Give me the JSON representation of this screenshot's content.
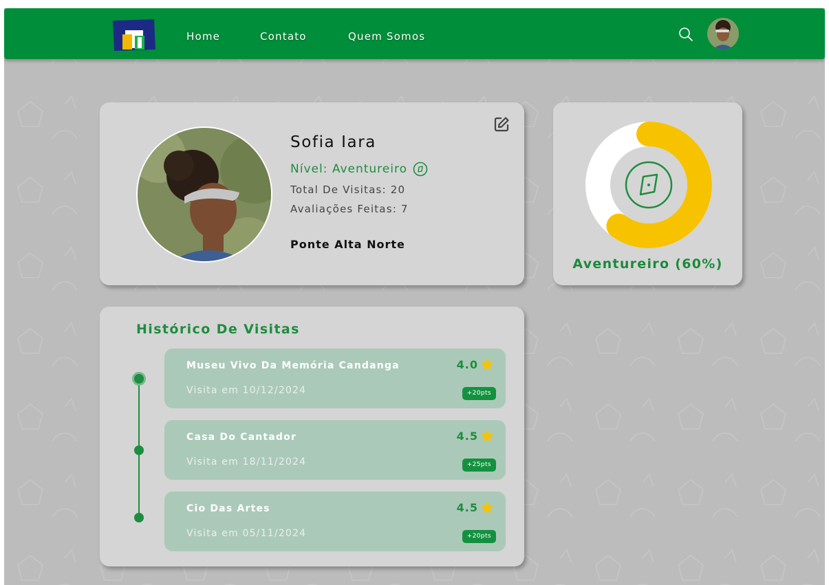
{
  "nav": {
    "links": [
      "Home",
      "Contato",
      "Quem Somos"
    ],
    "icons": {
      "logo": "logo-icon",
      "search": "search-icon",
      "avatar": "user-avatar"
    }
  },
  "profile": {
    "name": "Sofia Iara",
    "level": "Nível: Aventureiro",
    "total_visits": "Total De Visitas: 20",
    "reviews": "Avaliações Feitas: 7",
    "city": "Ponte Alta Norte",
    "icons": {
      "edit": "edit-icon",
      "level": "compass-icon"
    }
  },
  "level_progress": {
    "label": "Aventureiro (60%)",
    "percent": 60,
    "icon": "compass-icon"
  },
  "history": {
    "title": "Histórico De Visitas",
    "items": [
      {
        "name": "Museu Vivo Da Memória Candanga",
        "date": "Visita em 10/12/2024",
        "rating": "4.0",
        "points": "+20pts"
      },
      {
        "name": "Casa Do Cantador",
        "date": "Visita em 18/11/2024",
        "rating": "4.5",
        "points": "+25pts"
      },
      {
        "name": "Cio Das Artes",
        "date": "Visita em 05/11/2024",
        "rating": "4.5",
        "points": "+20pts"
      }
    ]
  },
  "colors": {
    "brand_green": "#008e3a",
    "accent_yellow": "#f7c200",
    "card_bg": "#d5d5d5",
    "visit_bg": "#abc9b9",
    "page_bg": "#bcbcbc"
  }
}
